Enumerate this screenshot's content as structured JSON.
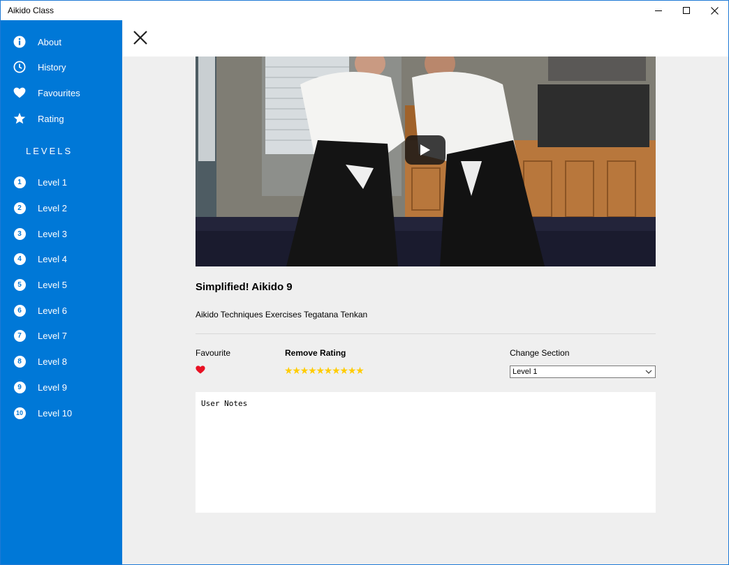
{
  "window": {
    "title": "Aikido Class"
  },
  "sidebar": {
    "items": [
      {
        "label": "About",
        "icon": "info-icon"
      },
      {
        "label": "History",
        "icon": "clock-icon"
      },
      {
        "label": "Favourites",
        "icon": "heart-icon"
      },
      {
        "label": "Rating",
        "icon": "star-icon"
      }
    ],
    "levels_heading": "LEVELS",
    "levels": [
      {
        "num": "1",
        "label": "Level 1"
      },
      {
        "num": "2",
        "label": "Level 2"
      },
      {
        "num": "3",
        "label": "Level 3"
      },
      {
        "num": "4",
        "label": "Level 4"
      },
      {
        "num": "5",
        "label": "Level 5"
      },
      {
        "num": "6",
        "label": "Level 6"
      },
      {
        "num": "7",
        "label": "Level 7"
      },
      {
        "num": "8",
        "label": "Level 8"
      },
      {
        "num": "9",
        "label": "Level 9"
      },
      {
        "num": "10",
        "label": "Level 10"
      }
    ]
  },
  "video": {
    "title": "Simplified! Aikido 9",
    "description": "Aikido Techniques Exercises Tegatana Tenkan"
  },
  "details": {
    "favourite_label": "Favourite",
    "rating_label": "Remove Rating",
    "rating_value": 10,
    "rating_max": 10,
    "section_label": "Change Section",
    "section_selected": "Level 1"
  },
  "notes": {
    "placeholder": "User Notes"
  },
  "colors": {
    "accent": "#0078d7",
    "star": "#ffcc00",
    "heart": "#e81123"
  }
}
